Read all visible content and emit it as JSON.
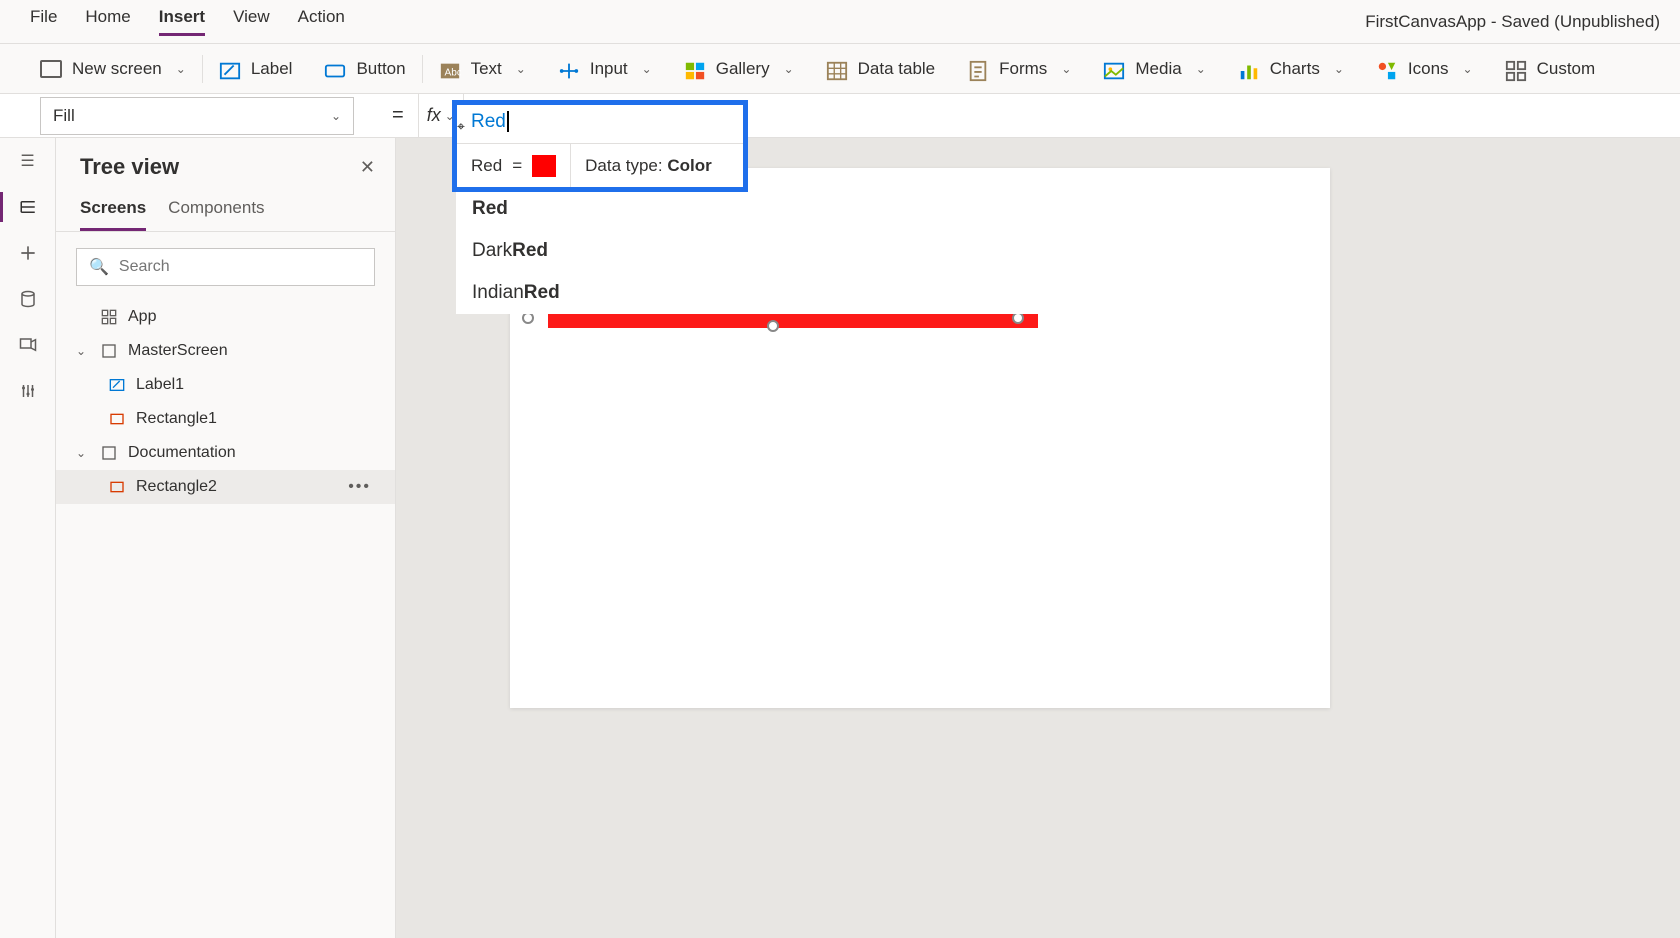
{
  "menu": {
    "items": [
      "File",
      "Home",
      "Insert",
      "View",
      "Action"
    ],
    "active_index": 2,
    "app_title": "FirstCanvasApp - Saved (Unpublished)"
  },
  "ribbon": {
    "new_screen": "New screen",
    "label": "Label",
    "button": "Button",
    "text": "Text",
    "input": "Input",
    "gallery": "Gallery",
    "data_table": "Data table",
    "forms": "Forms",
    "media": "Media",
    "charts": "Charts",
    "icons": "Icons",
    "custom": "Custom"
  },
  "formula": {
    "property": "Fill",
    "value": "Red",
    "tooltip_name": "Red",
    "tooltip_eq": "=",
    "tooltip_color": "#ff0000",
    "datatype_label": "Data type: ",
    "datatype_value": "Color"
  },
  "autocomplete": [
    {
      "prefix": "",
      "match": "Red"
    },
    {
      "prefix": "Dark",
      "match": "Red"
    },
    {
      "prefix": "Indian",
      "match": "Red"
    }
  ],
  "tree": {
    "title": "Tree view",
    "tabs": {
      "screens": "Screens",
      "components": "Components"
    },
    "search_placeholder": "Search",
    "nodes": {
      "app": "App",
      "master_screen": "MasterScreen",
      "label1": "Label1",
      "rectangle1": "Rectangle1",
      "documentation": "Documentation",
      "rectangle2": "Rectangle2"
    }
  },
  "canvas": {
    "selected_fill": "#fd1a18"
  }
}
